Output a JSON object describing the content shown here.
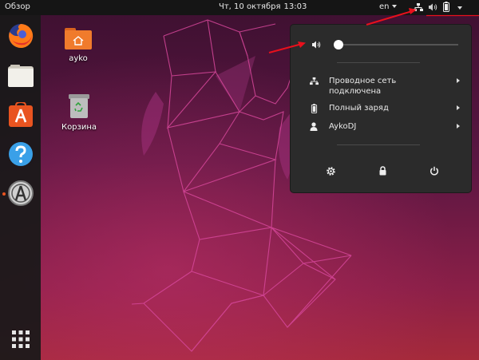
{
  "topbar": {
    "overview_label": "Обзор",
    "date": "Чт, 10 октября",
    "time": "13:03",
    "language": "en",
    "icons": [
      "network-wired-icon",
      "volume-icon",
      "battery-icon",
      "menu-caret-icon"
    ]
  },
  "dock": {
    "apps": [
      {
        "name": "firefox",
        "icon": "firefox-icon"
      },
      {
        "name": "files",
        "icon": "folder-icon"
      },
      {
        "name": "software",
        "icon": "software-center-icon"
      },
      {
        "name": "help",
        "icon": "help-icon"
      },
      {
        "name": "updater",
        "icon": "software-updater-icon",
        "running": true
      }
    ],
    "show_apps_icon": "app-grid-icon"
  },
  "desktop": {
    "icons": [
      {
        "label": "ayko",
        "icon": "home-folder-icon"
      },
      {
        "label": "Корзина",
        "icon": "trash-icon"
      }
    ]
  },
  "system_menu": {
    "volume": {
      "icon": "volume-icon",
      "level": 0.0
    },
    "items": [
      {
        "icon": "network-wired-icon",
        "label_line1": "Проводное сеть",
        "label_line2": "подключена"
      },
      {
        "icon": "battery-icon",
        "label_line1": "Полный заряд",
        "label_line2": ""
      },
      {
        "icon": "user-icon",
        "label_line1": "AykoDJ",
        "label_line2": ""
      }
    ],
    "actions": [
      "settings-icon",
      "lock-icon",
      "power-icon"
    ]
  },
  "colors": {
    "topbar": "#151515",
    "menu_bg": "#2b2b2b",
    "accent": "#e95420",
    "annotation_arrow": "#e8101c"
  }
}
